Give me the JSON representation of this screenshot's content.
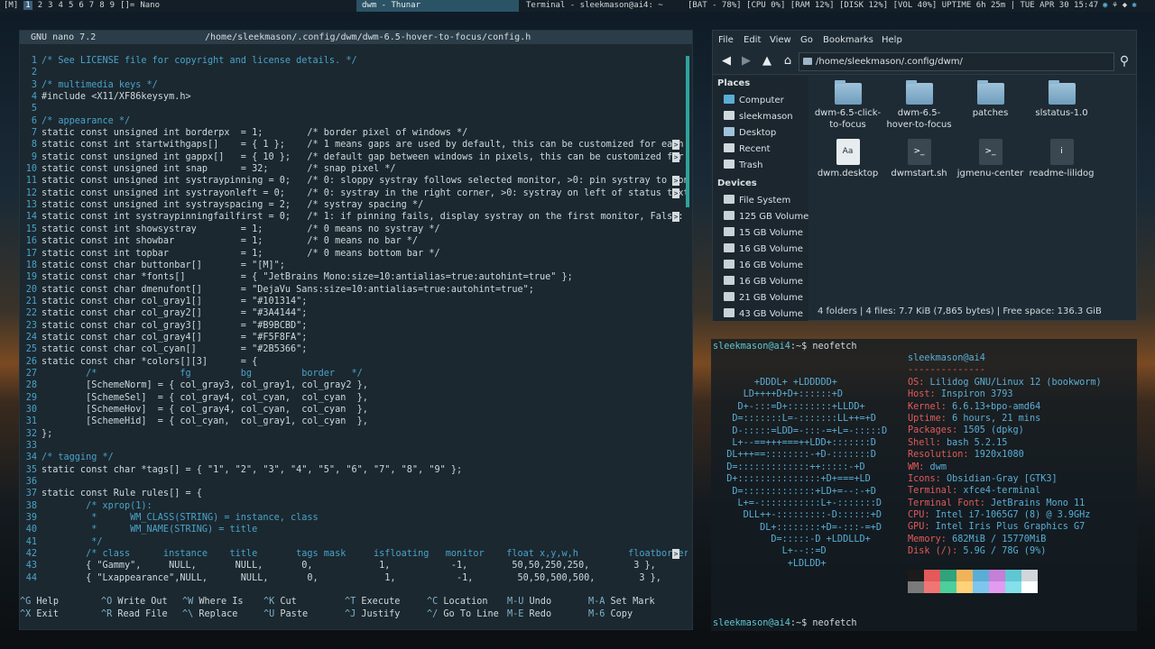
{
  "bar": {
    "layout": "[M]",
    "tags": [
      "1",
      "2",
      "3",
      "4",
      "5",
      "6",
      "7",
      "8",
      "9",
      "[]=",
      "Nano"
    ],
    "current_tag": "1",
    "win_title_active": "dwm - Thunar",
    "win_title_other": "Terminal - sleekmason@ai4: ~",
    "status": "[BAT - 78%] [CPU 0%] [RAM 12%] [DISK 12%] [VOL 40%] UPTIME 6h 25m | TUE APR 30 15:47"
  },
  "nano": {
    "version": "GNU nano 7.2",
    "file": "/home/sleekmason/.config/dwm/dwm-6.5-hover-to-focus/config.h",
    "lines": [
      "/* See LICENSE file for copyright and license details. */",
      "",
      "/* multimedia keys */",
      "#include <X11/XF86keysym.h>",
      "",
      "/* appearance */",
      "static const unsigned int borderpx  = 1;        /* border pixel of windows */",
      "static const int startwithgaps[]    = { 1 };    /* 1 means gaps are used by default, this can be customized for each t",
      "static const unsigned int gappx[]   = { 10 };   /* default gap between windows in pixels, this can be customized for e",
      "static const unsigned int snap      = 32;       /* snap pixel */",
      "static const unsigned int systraypinning = 0;   /* 0: sloppy systray follows selected monitor, >0: pin systray to moni",
      "static const unsigned int systrayonleft = 0;    /* 0: systray in the right corner, >0: systray on left of status text ",
      "static const unsigned int systrayspacing = 2;   /* systray spacing */",
      "static const int systraypinningfailfirst = 0;   /* 1: if pinning fails, display systray on the first monitor, False: d",
      "static const int showsystray        = 1;        /* 0 means no systray */",
      "static const int showbar            = 1;        /* 0 means no bar */",
      "static const int topbar             = 1;        /* 0 means bottom bar */",
      "static const char buttonbar[]       = \"[M]\";",
      "static const char *fonts[]          = { \"JetBrains Mono:size=10:antialias=true:autohint=true\" };",
      "static const char dmenufont[]       = \"DejaVu Sans:size=10:antialias=true:autohint=true\";",
      "static const char col_gray1[]       = \"#101314\";",
      "static const char col_gray2[]       = \"#3A4144\";",
      "static const char col_gray3[]       = \"#B9BCBD\";",
      "static const char col_gray4[]       = \"#F5F8FA\";",
      "static const char col_cyan[]        = \"#2B5366\";",
      "static const char *colors[][3]      = {",
      "        /*               fg         bg         border   */",
      "        [SchemeNorm] = { col_gray3, col_gray1, col_gray2 },",
      "        [SchemeSel]  = { col_gray4, col_cyan,  col_cyan  },",
      "        [SchemeHov]  = { col_gray4, col_cyan,  col_cyan  },",
      "        [SchemeHid]  = { col_cyan,  col_gray1, col_cyan  },",
      "};",
      "",
      "/* tagging */",
      "static const char *tags[] = { \"1\", \"2\", \"3\", \"4\", \"5\", \"6\", \"7\", \"8\", \"9\" };",
      "",
      "static const Rule rules[] = {",
      "        /* xprop(1):",
      "         *      WM_CLASS(STRING) = instance, class",
      "         *      WM_NAME(STRING) = title",
      "         */",
      "        /* class      instance    title       tags mask     isfloating   monitor    float x,y,w,h         floatborderp",
      "        { \"Gammy\",     NULL,       NULL,       0,            1,           -1,        50,50,250,250,        3 },",
      "        { \"Lxappearance\",NULL,      NULL,       0,            1,           -1,        50,50,500,500,        3 },"
    ],
    "more_rows": [
      8,
      9,
      11,
      12,
      14,
      42
    ],
    "shortcuts": [
      [
        [
          "^G",
          "Help"
        ],
        [
          "^O",
          "Write Out"
        ],
        [
          "^W",
          "Where Is"
        ],
        [
          "^K",
          "Cut"
        ],
        [
          "^T",
          "Execute"
        ],
        [
          "^C",
          "Location"
        ],
        [
          "M-U",
          "Undo"
        ],
        [
          "M-A",
          "Set Mark"
        ]
      ],
      [
        [
          "^X",
          "Exit"
        ],
        [
          "^R",
          "Read File"
        ],
        [
          "^\\",
          "Replace"
        ],
        [
          "^U",
          "Paste"
        ],
        [
          "^J",
          "Justify"
        ],
        [
          "^/",
          "Go To Line"
        ],
        [
          "M-E",
          "Redo"
        ],
        [
          "M-6",
          "Copy"
        ]
      ]
    ]
  },
  "thunar": {
    "menu": [
      "File",
      "Edit",
      "View",
      "Go",
      "Bookmarks",
      "Help"
    ],
    "path": "/home/sleekmason/.config/dwm/",
    "places_header": "Places",
    "places": [
      "Computer",
      "sleekmason",
      "Desktop",
      "Recent",
      "Trash"
    ],
    "devices_header": "Devices",
    "devices": [
      "File System",
      "125 GB Volume",
      "15 GB Volume",
      "16 GB Volume",
      "16 GB Volume",
      "16 GB Volume",
      "21 GB Volume",
      "43 GB Volume"
    ],
    "items": [
      {
        "name": "dwm-6.5-click-to-focus",
        "icon": "folder-icon"
      },
      {
        "name": "dwm-6.5-hover-to-focus",
        "icon": "folder-icon"
      },
      {
        "name": "patches",
        "icon": "folder-icon"
      },
      {
        "name": "slstatus-1.0",
        "icon": "folder-icon"
      },
      {
        "name": "dwm.desktop",
        "icon": "theme-file-icon"
      },
      {
        "name": "dwmstart.sh",
        "icon": "shell-script-icon"
      },
      {
        "name": "jgmenu-center",
        "icon": "shell-script-icon"
      },
      {
        "name": "readme-lilidog",
        "icon": "info-file-icon"
      }
    ],
    "status": "4 folders  |  4 files: 7.7 KiB (7,865 bytes)  |  Free space: 136.3 GiB"
  },
  "terminal": {
    "prompt_user": "sleekmason@ai4",
    "prompt_rest": ":~$ ",
    "command": "neofetch",
    "logo": [
      "       +DDDL+ +LDDDDD+",
      "     LD++++D+D+::::::+D",
      "    D+-:::=D+::::::::+LLDD+",
      "   D=:::::::L=-:::::::LL++=+D",
      "   D-:::::=LDD=-:::-=+L=-:::::D",
      "   L+--==+++===++LDD+:::::::D",
      "  DL+++==::::::::-+D-:::::::D",
      "  D=:::::::::::::++:::::-+D",
      "  D+:::::::::::::::+D+===+LD",
      "   D=:::::::::::::+LD+=--:-+D",
      "    L+=-:::::::::::L+-:::::::D",
      "     DLL++-:::::::::-D::::::+D",
      "        DL+::::::::+D=-:::-=+D",
      "          D=:::::-D +LDDLLD+",
      "            L+--::=D",
      "             +LDLDD+"
    ],
    "info_user": "sleekmason@ai4",
    "info_sep": "--------------",
    "info": [
      [
        "OS",
        "Lilidog GNU/Linux 12 (bookworm)"
      ],
      [
        "Host",
        "Inspiron 3793"
      ],
      [
        "Kernel",
        "6.6.13+bpo-amd64"
      ],
      [
        "Uptime",
        "6 hours, 21 mins"
      ],
      [
        "Packages",
        "1505 (dpkg)"
      ],
      [
        "Shell",
        "bash 5.2.15"
      ],
      [
        "Resolution",
        "1920x1080"
      ],
      [
        "WM",
        "dwm"
      ],
      [
        "Icons",
        "Obsidian-Gray [GTK3]"
      ],
      [
        "Terminal",
        "xfce4-terminal"
      ],
      [
        "Terminal Font",
        "JetBrains Mono 11"
      ],
      [
        "CPU",
        "Intel i7-1065G7 (8) @ 3.9GHz"
      ],
      [
        "GPU",
        "Intel Iris Plus Graphics G7"
      ],
      [
        "Memory",
        "682MiB / 15770MiB"
      ],
      [
        "Disk (/)",
        "5.9G / 78G (9%)"
      ]
    ],
    "colors_row1": [
      "#1b1b1b",
      "#e25a5a",
      "#2fa37a",
      "#f0b35a",
      "#5aaed6",
      "#c47fd6",
      "#5fc7d3",
      "#d0d6d9"
    ],
    "colors_row2": [
      "#7a7a7a",
      "#f07575",
      "#4ccf9a",
      "#ffd27a",
      "#7ec6ee",
      "#e29bf0",
      "#84e0ea",
      "#ffffff"
    ]
  }
}
